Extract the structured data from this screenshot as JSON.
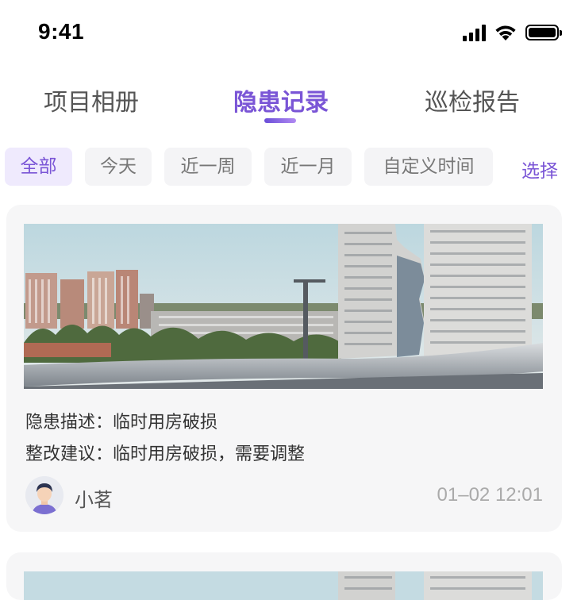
{
  "status_bar": {
    "time": "9:41",
    "icons": [
      "signal-icon",
      "wifi-icon",
      "battery-icon"
    ]
  },
  "tabs": [
    {
      "label": "项目相册",
      "active": false
    },
    {
      "label": "隐患记录",
      "active": true
    },
    {
      "label": "巡检报告",
      "active": false
    }
  ],
  "filters": {
    "chips": [
      {
        "label": "全部",
        "active": true
      },
      {
        "label": "今天",
        "active": false
      },
      {
        "label": "近一周",
        "active": false
      },
      {
        "label": "近一月",
        "active": false
      },
      {
        "label": "自定义时间",
        "active": false
      }
    ],
    "select_label": "选择"
  },
  "records": [
    {
      "image": "construction-site-photo",
      "description": "隐患描述：临时用房破损",
      "suggestion": "整改建议：临时用房破损，需要调整",
      "user": "小茗",
      "time": "01–02 12:01"
    },
    {
      "image": "construction-site-photo"
    }
  ],
  "colors": {
    "accent": "#7a55d6",
    "card_bg": "#f6f6f7",
    "chip_bg": "#f4f4f6",
    "chip_active_bg": "#efeafd"
  }
}
